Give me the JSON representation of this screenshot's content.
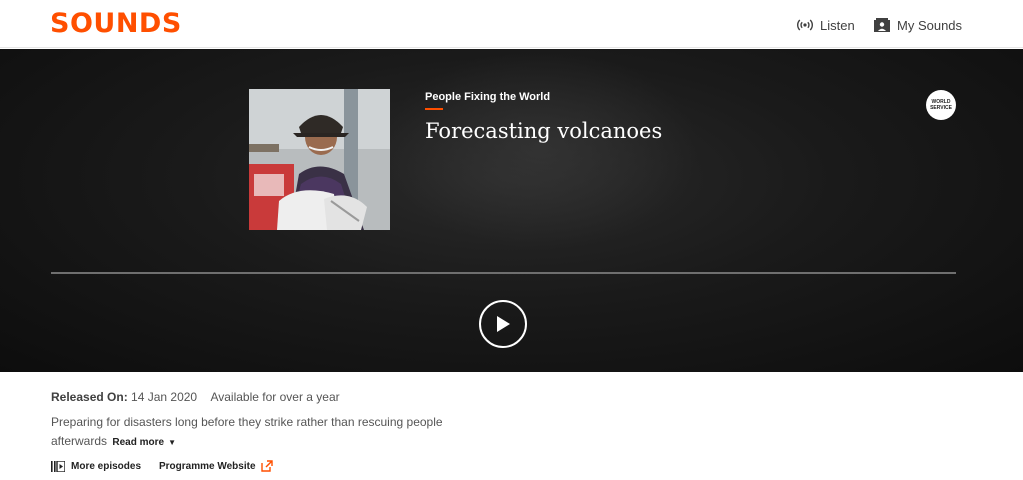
{
  "brand": {
    "logo_text": "SOUNDS",
    "accent_color": "#ff4f00"
  },
  "nav": {
    "listen_label": "Listen",
    "listen_icon": "broadcast-icon",
    "my_sounds_label": "My Sounds",
    "my_sounds_icon": "my-sounds-icon"
  },
  "episode": {
    "series_title": "People Fixing the World",
    "title": "Forecasting volcanoes",
    "network_badge_line1": "WORLD",
    "network_badge_line2": "SERVICE",
    "play_icon": "play-icon"
  },
  "meta": {
    "released_label": "Released On:",
    "released_date": "14 Jan 2020",
    "availability": "Available for over a year",
    "description": "Preparing for disasters long before they strike rather than rescuing people afterwards",
    "read_more_label": "Read more"
  },
  "links": {
    "more_episodes_label": "More episodes",
    "programme_website_label": "Programme Website"
  }
}
